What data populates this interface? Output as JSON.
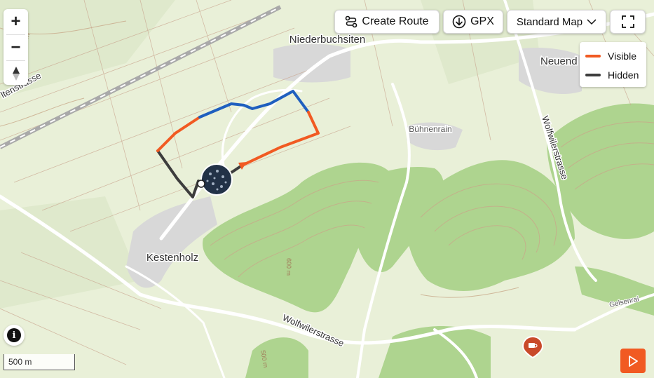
{
  "map": {
    "place_labels": {
      "niederbuchsiten": "Niederbuchsiten",
      "kestenholz": "Kestenholz",
      "buehnenrain": "Bühnenrain",
      "neuendorf": "Neuend",
      "wolfwilerstrasse_south": "Wolfwilerstrasse",
      "wolfwilerstrasse_east": "Wolfwilerstrasse",
      "street_left": "ltenstrasse",
      "gelsenrai": "Gelsenrai",
      "contour_500": "500 m",
      "contour_600": "600 m",
      "contour_500b": "500 m"
    },
    "colors": {
      "background": "#e9f0d8",
      "forest": "#aed48f",
      "route_visible": "#f15a22",
      "route_hidden": "#3d3d3d",
      "route_blue": "#1f5fbf",
      "contour": "#c8a98a",
      "road": "#ffffff"
    }
  },
  "toolbar": {
    "create_route": "Create Route",
    "create_route_icon": "route-icon",
    "gpx": "GPX",
    "gpx_icon": "download-icon",
    "map_style": "Standard Map",
    "map_style_icon": "chevron-down-icon",
    "fullscreen_icon": "fullscreen-icon"
  },
  "zoom": {
    "in": "+",
    "out": "−",
    "compass_icon": "compass-icon"
  },
  "legend": {
    "visible_label": "Visible",
    "hidden_label": "Hidden",
    "visible_color": "#f15a22",
    "hidden_color": "#3d3d3d"
  },
  "info": {
    "symbol": "i",
    "icon": "info-icon"
  },
  "scale": {
    "label": "500 m"
  },
  "play": {
    "icon": "play-icon"
  },
  "poi": {
    "icon": "cafe-icon"
  }
}
